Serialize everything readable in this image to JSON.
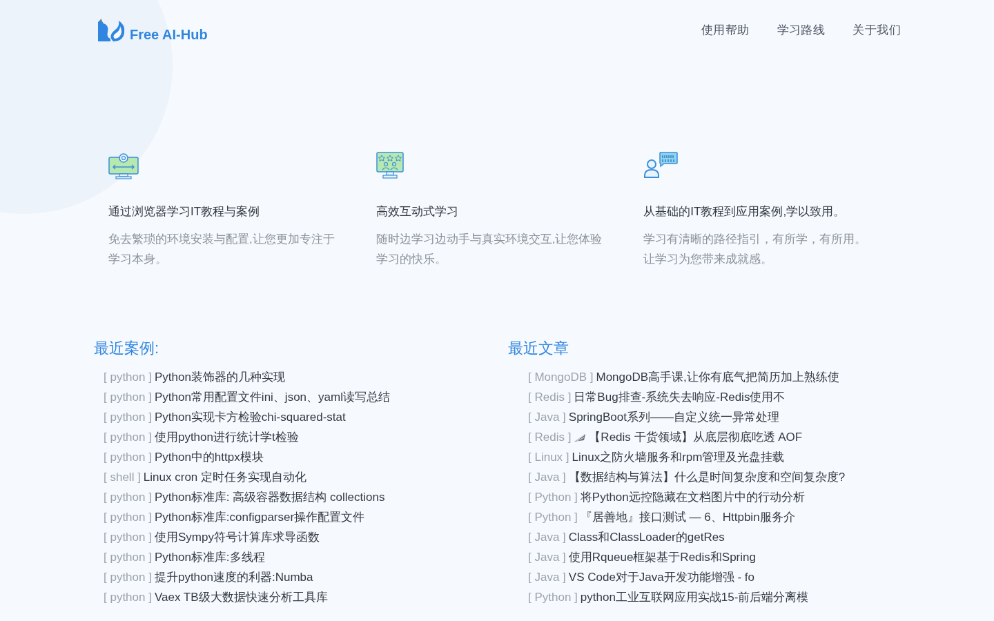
{
  "logo": {
    "text": "Free AI-Hub"
  },
  "nav": [
    "使用帮助",
    "学习路线",
    "关于我们"
  ],
  "features": [
    {
      "kind": "tools",
      "title": "通过浏览器学习IT教程与案例",
      "desc": "免去繁琐的环境安装与配置,让您更加专注于学习本身。"
    },
    {
      "kind": "interactive",
      "title": "高效互动式学习",
      "desc": "随时边学习边动手与真实环境交互,让您体验学习的快乐。"
    },
    {
      "kind": "chat",
      "title": "从基础的IT教程到应用案例,学以致用。",
      "desc": "学习有清晰的路径指引，有所学，有所用。让学习为您带来成就感。"
    }
  ],
  "cases": {
    "title": "最近案例:",
    "items": [
      {
        "tag": "[ python ]",
        "title": "Python装饰器的几种实现"
      },
      {
        "tag": "[ python ]",
        "title": "Python常用配置文件ini、json、yaml读写总结"
      },
      {
        "tag": "[ python ]",
        "title": "Python实现卡方检验chi-squared-stat"
      },
      {
        "tag": "[ python ]",
        "title": "使用python进行统计学t检验"
      },
      {
        "tag": "[ python ]",
        "title": "Python中的httpx模块"
      },
      {
        "tag": "[ shell ]",
        "title": "Linux cron 定时任务实现自动化"
      },
      {
        "tag": "[ python ]",
        "title": "Python标准库: 高级容器数据结构 collections"
      },
      {
        "tag": "[ python ]",
        "title": "Python标准库:configparser操作配置文件"
      },
      {
        "tag": "[ python ]",
        "title": "使用Sympy符号计算库求导函数"
      },
      {
        "tag": "[ python ]",
        "title": "Python标准库:多线程"
      },
      {
        "tag": "[ python ]",
        "title": "提升python速度的利器:Numba"
      },
      {
        "tag": "[ python ]",
        "title": "Vaex TB级大数据快速分析工具库"
      }
    ]
  },
  "articles": {
    "title": "最近文章",
    "items": [
      {
        "tag": "[ MongoDB ]",
        "title": "MongoDB高手课,让你有底气把简历加上熟练使",
        "has_icon": false
      },
      {
        "tag": "[ Redis ]",
        "title": "日常Bug排查-系统失去响应-Redis使用不",
        "has_icon": false
      },
      {
        "tag": "[ Java ]",
        "title": "SpringBoot系列——自定义统一异常处理",
        "has_icon": false
      },
      {
        "tag": "[ Redis ]",
        "title": "【Redis 干货领域】从底层彻底吃透 AOF",
        "has_icon": true
      },
      {
        "tag": "[ Linux ]",
        "title": "Linux之防火墙服务和rpm管理及光盘挂载",
        "has_icon": false
      },
      {
        "tag": "[ Java ]",
        "title": "【数据结构与算法】什么是时间复杂度和空间复杂度?",
        "has_icon": false
      },
      {
        "tag": "[ Python ]",
        "title": "将Python远控隐藏在文档图片中的行动分析",
        "has_icon": false
      },
      {
        "tag": "[ Python ]",
        "title": "『居善地』接口测试 — 6、Httpbin服务介",
        "has_icon": false
      },
      {
        "tag": "[ Java ]",
        "title": "Class和ClassLoader的getRes",
        "has_icon": false
      },
      {
        "tag": "[ Java ]",
        "title": "使用Rqueue框架基于Redis和Spring",
        "has_icon": false
      },
      {
        "tag": "[ Java ]",
        "title": "VS Code对于Java开发功能增强 - fo",
        "has_icon": false
      },
      {
        "tag": "[ Python ]",
        "title": "python工业互联网应用实战15-前后端分离模",
        "has_icon": false
      }
    ]
  }
}
